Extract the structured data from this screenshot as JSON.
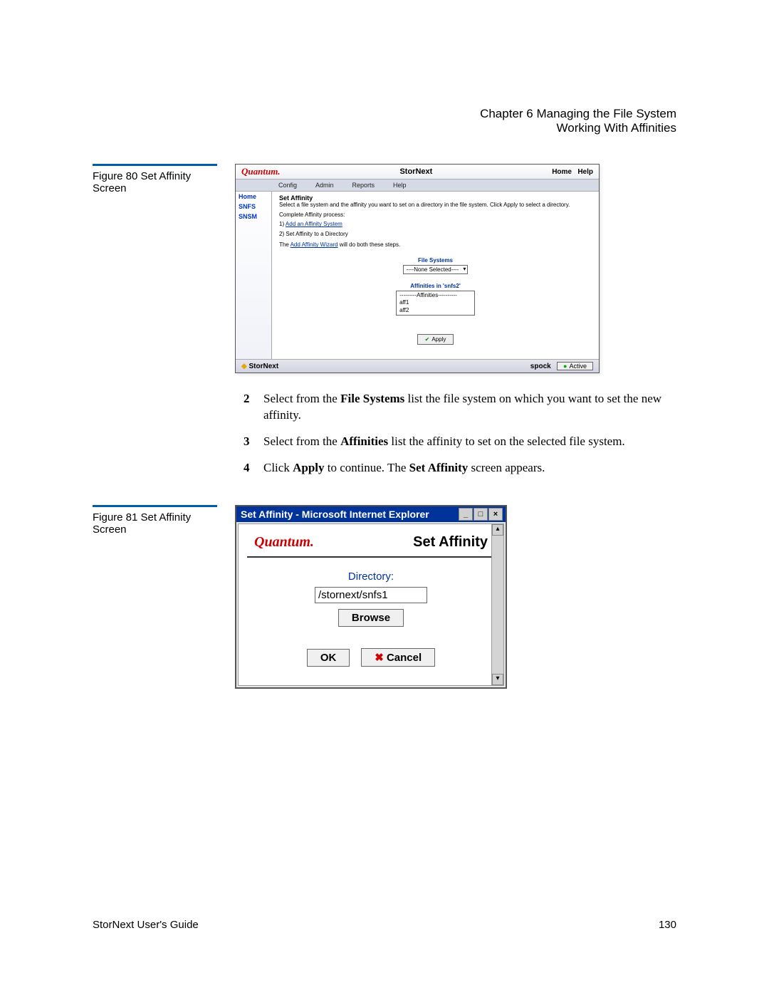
{
  "header": {
    "chapter": "Chapter 6  Managing the File System",
    "section": "Working With Affinities"
  },
  "figure80": {
    "label": "Figure 80  Set Affinity Screen"
  },
  "screenshot1": {
    "brand": "Quantum.",
    "app_title": "StorNext",
    "home_link": "Home",
    "help_link": "Help",
    "menu": [
      "Config",
      "Admin",
      "Reports",
      "Help"
    ],
    "sidebar": {
      "home": "Home",
      "snfs": "SNFS",
      "snsm": "SNSM"
    },
    "content": {
      "title": "Set Affinity",
      "desc": "Select a file system and the affinity you want to set on a directory in the file system. Click Apply to select a directory.",
      "process_label": "Complete Affinity process:",
      "process_step1_link": "Add an Affinity System",
      "process_step1_prefix": "1) ",
      "process_step2": "2) Set Affinity to a Directory",
      "wizard_prefix": "The ",
      "wizard_link": "Add Affinity Wizard",
      "wizard_suffix": " will do both these steps.",
      "fs_label": "File Systems",
      "fs_selected": "----None Selected----",
      "aff_label": "Affinities in 'snfs2'",
      "aff_options": [
        "---------Affinities----------",
        "aff1",
        "aff2"
      ],
      "apply": "Apply"
    },
    "footer": {
      "brand": "StorNext",
      "host": "spock",
      "status": "Active"
    }
  },
  "instructions": {
    "step2_prefix": "Select from the ",
    "step2_bold": "File Systems",
    "step2_suffix": " list the file system on which you want to set the new affinity.",
    "step3_prefix": "Select from the ",
    "step3_bold": "Affinities",
    "step3_suffix": " list the affinity to set on the selected file system.",
    "step4_prefix": "Click ",
    "step4_bold1": "Apply",
    "step4_mid": " to continue. The ",
    "step4_bold2": "Set Affinity",
    "step4_suffix": " screen appears."
  },
  "figure81": {
    "label": "Figure 81  Set Affinity Screen"
  },
  "dialog": {
    "title": "Set Affinity - Microsoft Internet Explorer",
    "brand": "Quantum.",
    "heading": "Set Affinity",
    "directory_label": "Directory:",
    "directory_value": "/stornext/snfs1",
    "browse": "Browse",
    "ok": "OK",
    "cancel": "Cancel"
  },
  "footer": {
    "guide": "StorNext User's Guide",
    "page": "130"
  }
}
